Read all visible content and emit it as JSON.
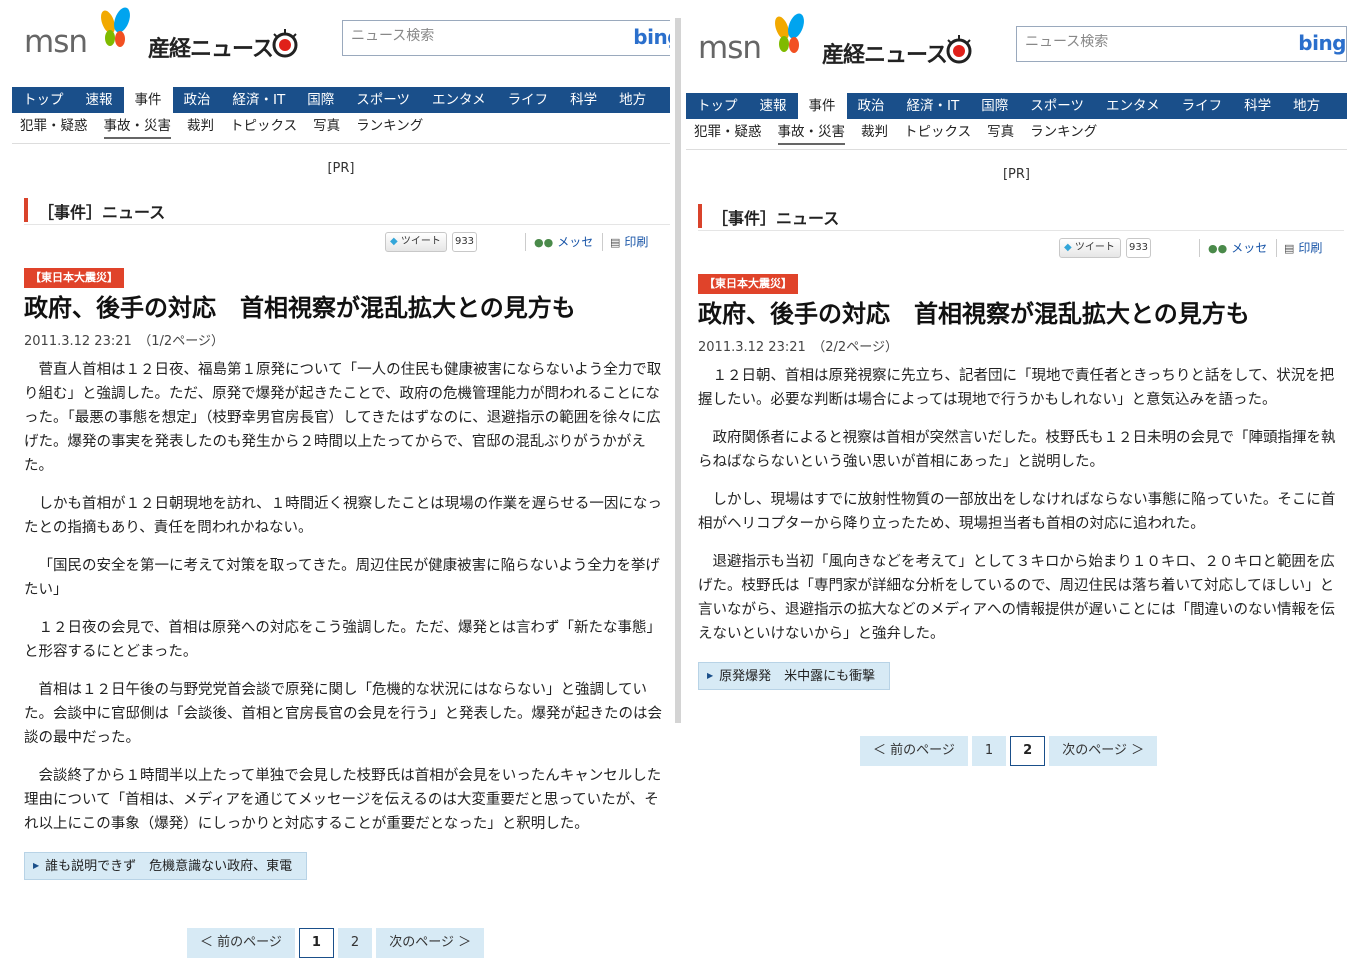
{
  "site": {
    "logo_msn": "msn",
    "logo_sankei": "産経ニュース",
    "search_placeholder": "ニュース検索",
    "search_engine": "bing",
    "nav_bg_color": "#1a4f8a",
    "badge_color": "#e0432a"
  },
  "nav": {
    "main": [
      "トップ",
      "速報",
      "事件",
      "政治",
      "経済・IT",
      "国際",
      "スポーツ",
      "エンタメ",
      "ライフ",
      "科学",
      "地方"
    ],
    "active_main": "事件",
    "sub": [
      "犯罪・疑惑",
      "事故・災害",
      "裁判",
      "トピックス",
      "写真",
      "ランキング"
    ],
    "active_sub": "事故・災害"
  },
  "ad_label": "[PR]",
  "section_title": "［事件］ニュース",
  "tools": {
    "tweet_label": "ツイート",
    "tweet_count": "933",
    "messenger_label": "メッセ",
    "print_label": "印刷"
  },
  "badge": "【東日本大震災】",
  "headline": "政府、後手の対応　首相視察が混乱拡大との見方も",
  "pager": {
    "prev": "＜ 前のページ",
    "next": "次のページ ＞",
    "pages": [
      "1",
      "2"
    ]
  },
  "page1": {
    "date": "2011.3.12 23:21",
    "page_indicator": "（1/2ページ）",
    "paragraphs": [
      "菅直人首相は１２日夜、福島第１原発について「一人の住民も健康被害にならないよう全力で取り組む」と強調した。ただ、原発で爆発が起きたことで、政府の危機管理能力が問われることになった。「最悪の事態を想定」（枝野幸男官房長官）してきたはずなのに、退避指示の範囲を徐々に広げた。爆発の事実を発表したのも発生から２時間以上たってからで、官邸の混乱ぶりがうかがえた。",
      "しかも首相が１２日朝現地を訪れ、１時間近く視察したことは現場の作業を遅らせる一因になったとの指摘もあり、責任を問われかねない。",
      "「国民の安全を第一に考えて対策を取ってきた。周辺住民が健康被害に陥らないよう全力を挙げたい」",
      "１２日夜の会見で、首相は原発への対応をこう強調した。ただ、爆発とは言わず「新たな事態」と形容するにとどまった。",
      "首相は１２日午後の与野党党首会談で原発に関し「危機的な状況にはならない」と強調していた。会談中に官邸側は「会談後、首相と官房長官の会見を行う」と発表した。爆発が起きたのは会談の最中だった。",
      "会談終了から１時間半以上たって単独で会見した枝野氏は首相が会見をいったんキャンセルした理由について「首相は、メディアを通じてメッセージを伝えるのは大変重要だと思っていたが、それ以上にこの事象（爆発）にしっかりと対応することが重要だとなった」と釈明した。"
    ],
    "related": "誰も説明できず　危機意識ない政府、東電",
    "current_page": "1"
  },
  "page2": {
    "date": "2011.3.12 23:21",
    "page_indicator": "（2/2ページ）",
    "paragraphs": [
      "１２日朝、首相は原発視察に先立ち、記者団に「現地で責任者ときっちりと話をして、状況を把握したい。必要な判断は場合によっては現地で行うかもしれない」と意気込みを語った。",
      "政府関係者によると視察は首相が突然言いだした。枝野氏も１２日未明の会見で「陣頭指揮を執らねばならないという強い思いが首相にあった」と説明した。",
      "しかし、現場はすでに放射性物質の一部放出をしなければならない事態に陥っていた。そこに首相がヘリコプターから降り立ったため、現場担当者も首相の対応に追われた。",
      "退避指示も当初「風向きなどを考えて」として３キロから始まり１０キロ、２０キロと範囲を広げた。枝野氏は「専門家が詳細な分析をしているので、周辺住民は落ち着いて対応してほしい」と言いながら、退避指示の拡大などのメディアへの情報提供が遅いことには「間違いのない情報を伝えないといけないから」と強弁した。"
    ],
    "related": "原発爆発　米中露にも衝撃",
    "current_page": "2"
  }
}
